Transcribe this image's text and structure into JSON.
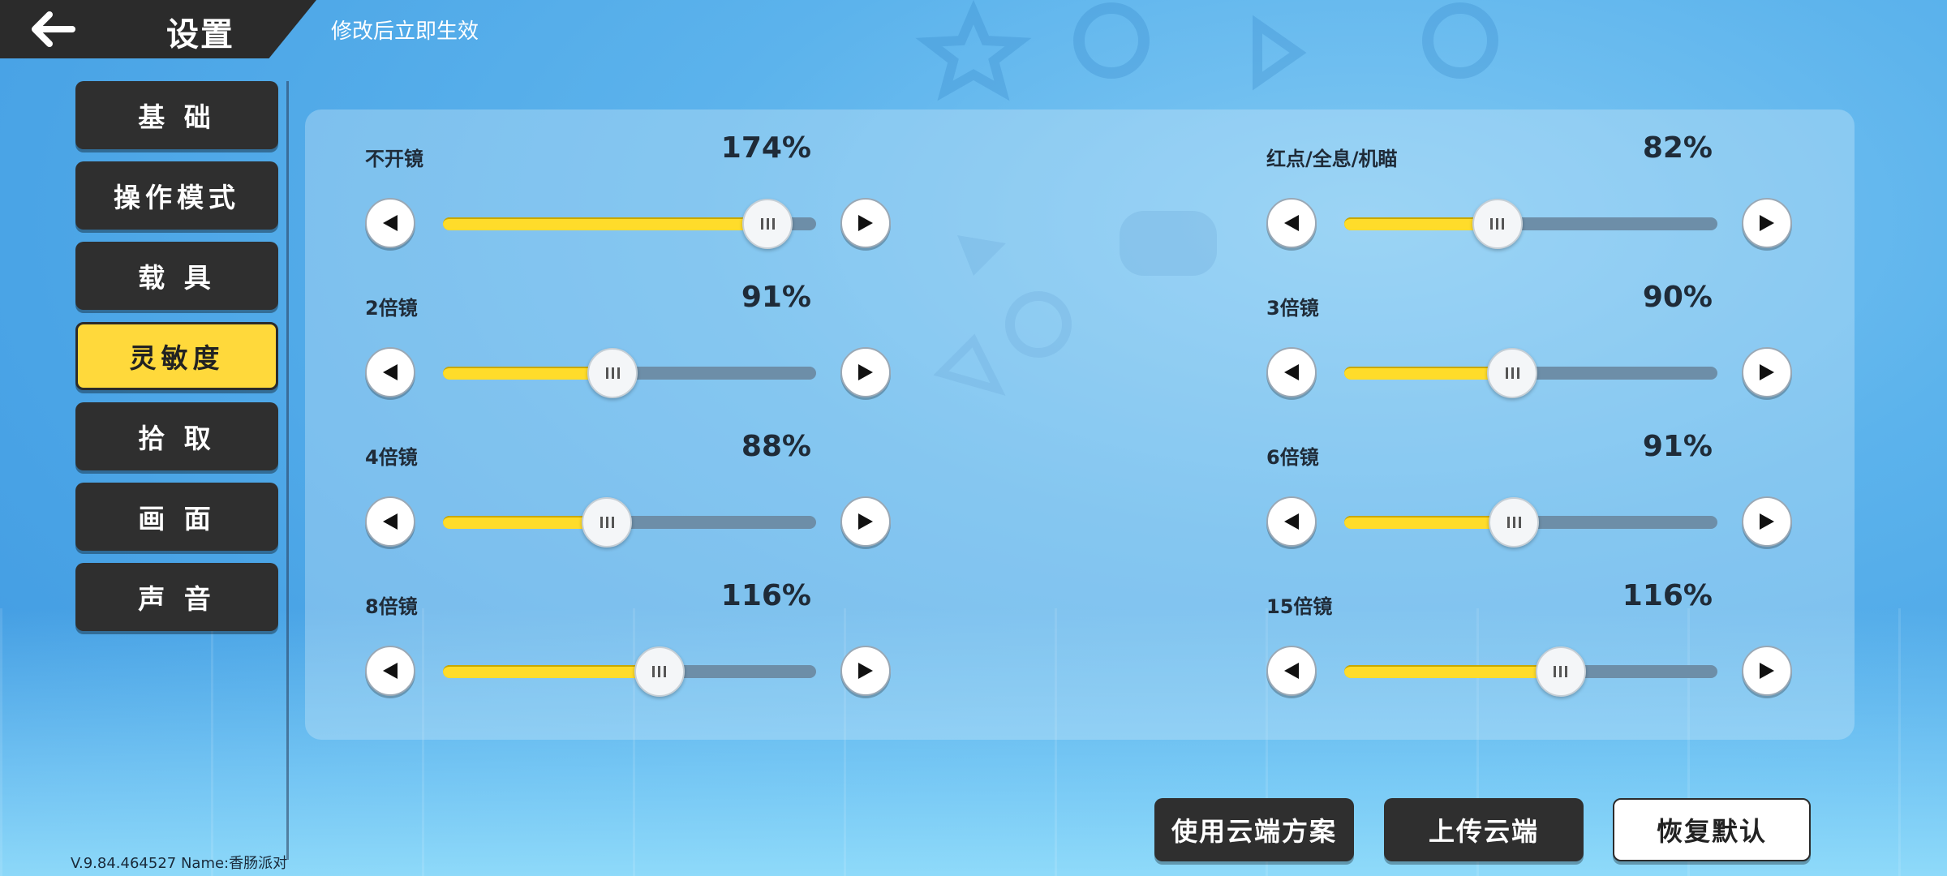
{
  "header": {
    "title": "设置",
    "subtitle": "修改后立即生效"
  },
  "sidebar": {
    "items": [
      {
        "label": "基 础",
        "active": false
      },
      {
        "label": "操作模式",
        "active": false
      },
      {
        "label": "载 具",
        "active": false
      },
      {
        "label": "灵敏度",
        "active": true
      },
      {
        "label": "拾 取",
        "active": false
      },
      {
        "label": "画 面",
        "active": false
      },
      {
        "label": "声 音",
        "active": false
      }
    ]
  },
  "sliders": [
    {
      "label": "不开镜",
      "value_text": "174%",
      "fraction": 0.87
    },
    {
      "label": "红点/全息/机瞄",
      "value_text": "82%",
      "fraction": 0.41
    },
    {
      "label": "2倍镜",
      "value_text": "91%",
      "fraction": 0.455
    },
    {
      "label": "3倍镜",
      "value_text": "90%",
      "fraction": 0.45
    },
    {
      "label": "4倍镜",
      "value_text": "88%",
      "fraction": 0.44
    },
    {
      "label": "6倍镜",
      "value_text": "91%",
      "fraction": 0.455
    },
    {
      "label": "8倍镜",
      "value_text": "116%",
      "fraction": 0.58
    },
    {
      "label": "15倍镜",
      "value_text": "116%",
      "fraction": 0.58
    }
  ],
  "buttons": {
    "cloud_use": "使用云端方案",
    "cloud_upload": "上传云端",
    "restore_default": "恢复默认"
  },
  "footer": {
    "version": "V.9.84.464527 Name:香肠派对"
  },
  "colors": {
    "accent": "#ffd93b",
    "dark": "#2f2f2f",
    "track": "#6d8ea8"
  }
}
